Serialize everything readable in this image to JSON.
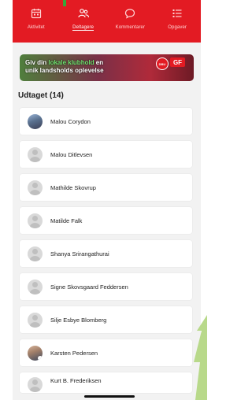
{
  "nav": {
    "items": [
      {
        "label": "Aktivitet",
        "icon": "calendar-icon",
        "active": false
      },
      {
        "label": "Deltagere",
        "icon": "people-icon",
        "active": true
      },
      {
        "label": "Kommentarer",
        "icon": "comment-icon",
        "active": false
      },
      {
        "label": "Opgaver",
        "icon": "list-icon",
        "active": false
      }
    ]
  },
  "banner": {
    "line1_start": "Giv din ",
    "line1_highlight": "lokale klubhold",
    "line1_end": " en",
    "line2": "unik landsholds oplevelse",
    "logo_dbu": "DBU",
    "logo_gf": "GF"
  },
  "section": {
    "title": "Udtaget (14)"
  },
  "participants": [
    {
      "name": "Malou Corydon",
      "avatar": "photo"
    },
    {
      "name": "Malou Ditlevsen",
      "avatar": "placeholder"
    },
    {
      "name": "Mathilde Skovrup",
      "avatar": "placeholder"
    },
    {
      "name": "Matilde Falk",
      "avatar": "placeholder"
    },
    {
      "name": "Shanya Srirangathurai",
      "avatar": "placeholder"
    },
    {
      "name": "Signe Skovsgaard Feddersen",
      "avatar": "placeholder"
    },
    {
      "name": "Silje Esbye Blomberg",
      "avatar": "placeholder"
    },
    {
      "name": "Karsten Pedersen",
      "avatar": "photo"
    },
    {
      "name": "Kurt B. Frederiksen",
      "avatar": "placeholder"
    }
  ],
  "colors": {
    "brand_red": "#e31b23",
    "background": "#f2f2f2",
    "card": "#ffffff"
  }
}
